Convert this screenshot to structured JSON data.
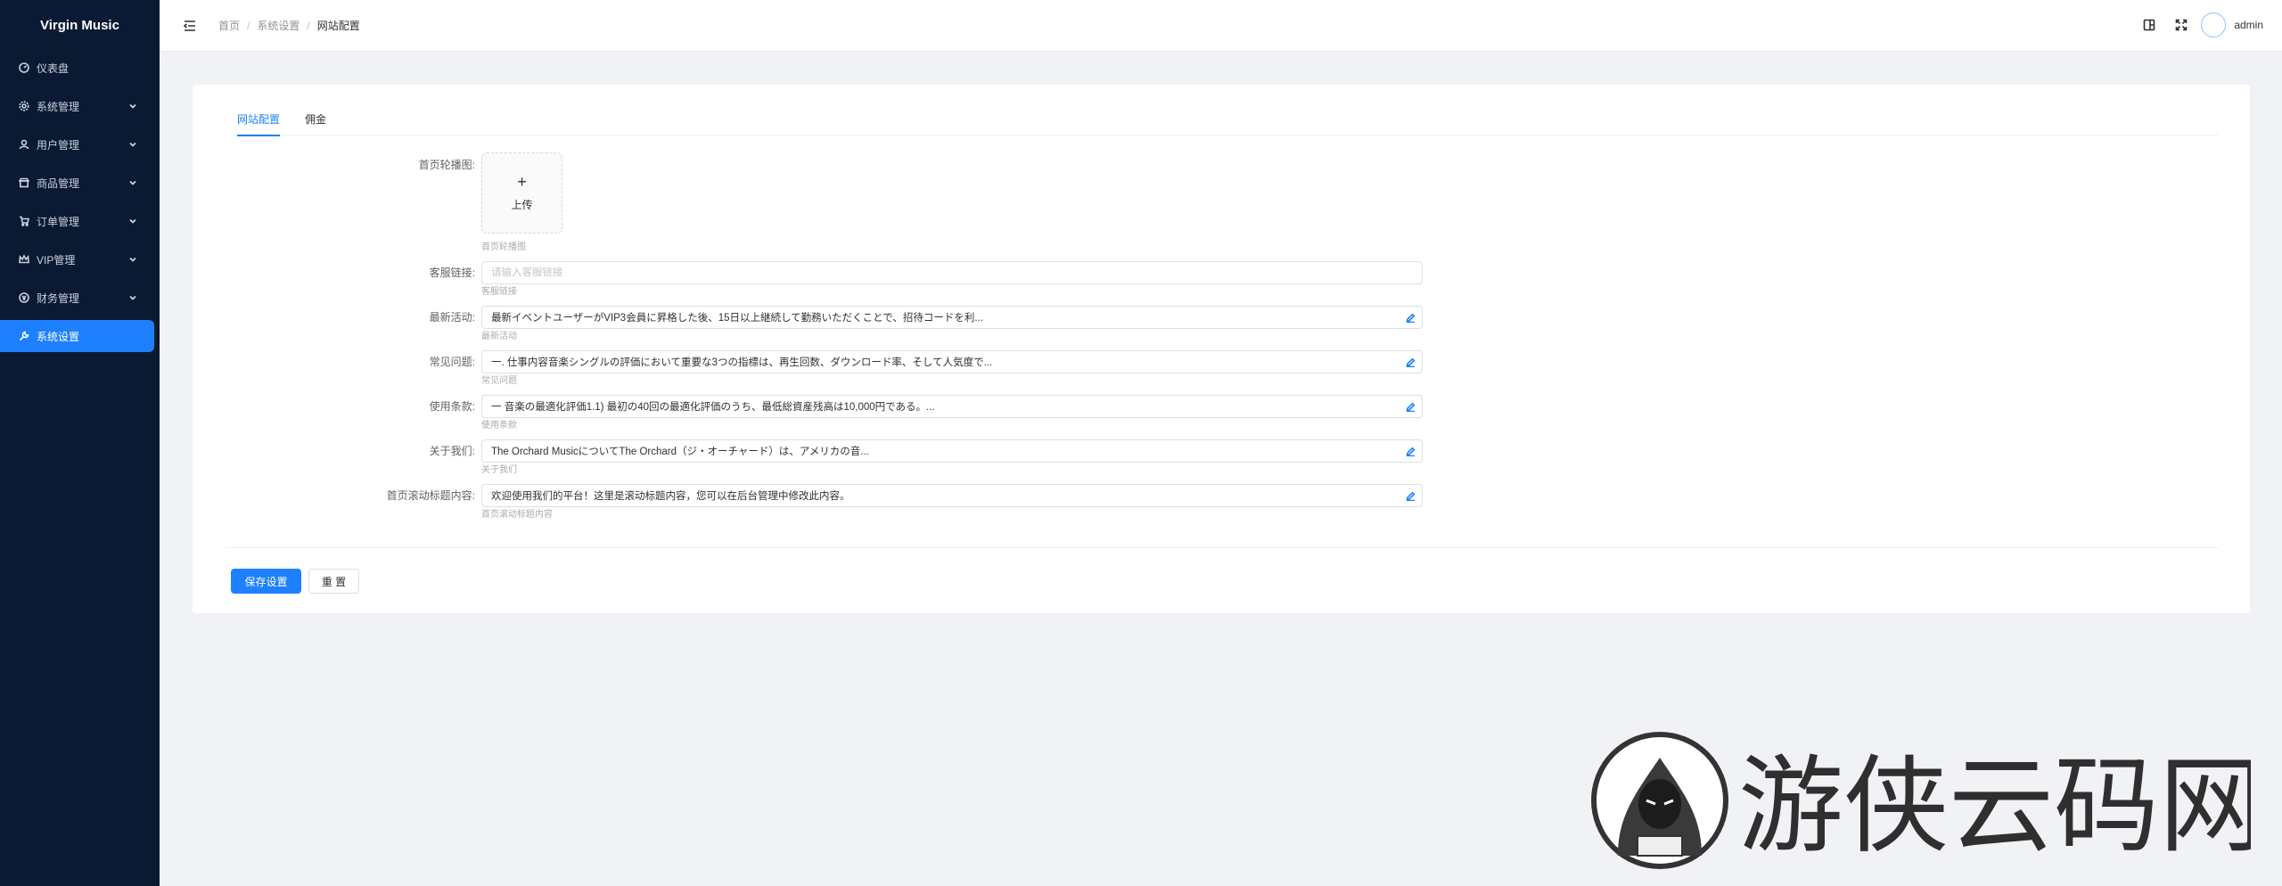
{
  "sidebar": {
    "brand": "Virgin Music",
    "items": [
      {
        "label": "仪表盘",
        "icon": "dashboard-icon",
        "has_children": false
      },
      {
        "label": "系统管理",
        "icon": "gear-icon",
        "has_children": true
      },
      {
        "label": "用户管理",
        "icon": "user-icon",
        "has_children": true
      },
      {
        "label": "商品管理",
        "icon": "shop-icon",
        "has_children": true
      },
      {
        "label": "订单管理",
        "icon": "cart-icon",
        "has_children": true
      },
      {
        "label": "VIP管理",
        "icon": "crown-icon",
        "has_children": true
      },
      {
        "label": "财务管理",
        "icon": "finance-icon",
        "has_children": true
      },
      {
        "label": "系统设置",
        "icon": "wrench-icon",
        "has_children": false,
        "active": true
      }
    ]
  },
  "header": {
    "breadcrumb": [
      "首页",
      "系统设置",
      "网站配置"
    ],
    "separator": "/",
    "username": "admin"
  },
  "tabs": [
    {
      "label": "网站配置",
      "active": true
    },
    {
      "label": "佣金",
      "active": false
    }
  ],
  "form": {
    "banner": {
      "label": "首页轮播图:",
      "upload_plus": "+",
      "upload_text": "上传",
      "hint": "首页轮播图"
    },
    "service_link": {
      "label": "客服链接:",
      "placeholder": "请输入客服链接",
      "hint": "客服链接"
    },
    "latest_activity": {
      "label": "最新活动:",
      "value": "最新イベントユーザーがVIP3会員に昇格した後、15日以上継続して勤務いただくことで、招待コードを利...",
      "hint": "最新活动"
    },
    "faq": {
      "label": "常见问题:",
      "value": "一. 仕事内容音楽シングルの評価において重要な3つの指標は、再生回数、ダウンロード率、そして人気度で...",
      "hint": "常见问题"
    },
    "terms": {
      "label": "使用条款:",
      "value": "一 音楽の最適化評価1.1) 最初の40回の最適化評価のうち、最低総資産残高は10,000円である。...",
      "hint": "使用条款"
    },
    "about": {
      "label": "关于我们:",
      "value": "The Orchard MusicについてThe Orchard（ジ・オーチャード）は、アメリカの音...",
      "hint": "关于我们"
    },
    "marquee": {
      "label": "首页滚动标题内容:",
      "value": "欢迎使用我们的平台！这里是滚动标题内容，您可以在后台管理中修改此内容。",
      "hint": "首页滚动标题内容"
    }
  },
  "actions": {
    "save": "保存设置",
    "reset": "重 置"
  },
  "colors": {
    "sidebar_bg": "#0b1a33",
    "accent": "#1e80ff",
    "page_bg": "#f0f2f5"
  },
  "watermark": {
    "text": "游侠云码网"
  }
}
